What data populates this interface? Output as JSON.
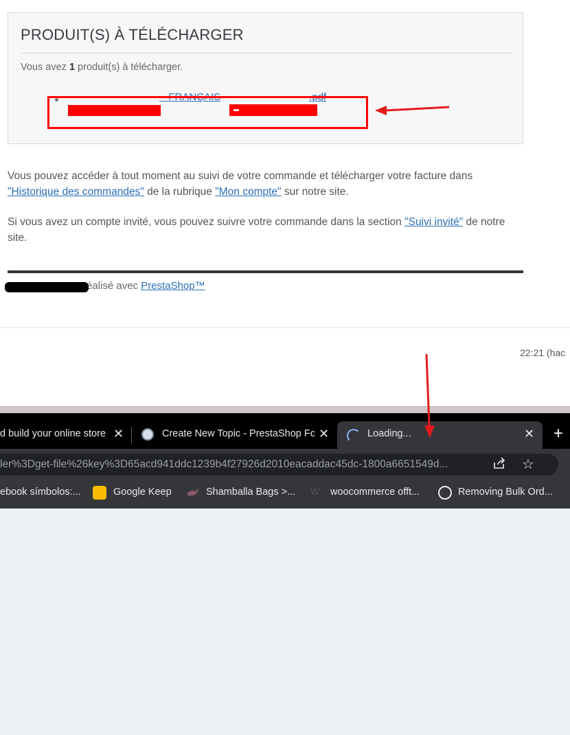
{
  "email": {
    "section_title": "PRODUIT(S) À TÉLÉCHARGER",
    "count_prefix": "Vous avez ",
    "count_value": "1",
    "count_suffix": " produit(s) à télécharger.",
    "product_link_mid": " - FRANÇAIS",
    "product_link_end": ".pdf",
    "para1_a": "Vous pouvez accéder à tout moment au suivi de votre commande et télécharger votre facture dans ",
    "para1_link1": "\"Historique des commandes\"",
    "para1_b": " de la rubrique ",
    "para1_link2": "\"Mon compte\"",
    "para1_c": " sur notre site.",
    "para2_a": "Si vous avez un compte invité, vous pouvez suivre votre commande dans la section ",
    "para2_link": "\"Suivi invité\"",
    "para2_b": " de notre site.",
    "footer_text": "réalisé avec ",
    "footer_link": "PrestaShop™",
    "timestamp": "22:21 (hac"
  },
  "browser": {
    "tabs": [
      {
        "title": "d build your online store"
      },
      {
        "title": "Create New Topic - PrestaShop Fo"
      },
      {
        "title": "Loading..."
      }
    ],
    "close_glyph": "✕",
    "new_tab_glyph": "+",
    "url": "ler%3Dget-file%26key%3D65acd941ddc1239b4f27926d2010eacaddac45dc-1800a6651549d...",
    "bookmarks": [
      {
        "label": "ebook símbolos:..."
      },
      {
        "label": "Google Keep"
      },
      {
        "label": "Shamballa Bags >..."
      },
      {
        "label": "woocommerce offt..."
      },
      {
        "label": "Removing Bulk Ord..."
      }
    ]
  },
  "colors": {
    "accent_link": "#2a6fb5",
    "annotation_red": "#ff0000",
    "chrome_dark": "#35363a"
  }
}
